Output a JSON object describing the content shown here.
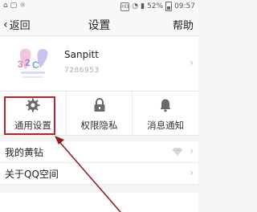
{
  "status_bar": {
    "battery_percent": "52%",
    "time": "09:57"
  },
  "nav": {
    "back_label": "返回",
    "title": "设置",
    "help_label": "帮助"
  },
  "profile": {
    "nickname": "Sanpitt",
    "qq_number": "7286953"
  },
  "grid": [
    {
      "label": "通用设置",
      "icon": "gear-icon"
    },
    {
      "label": "权限隐私",
      "icon": "lock-icon"
    },
    {
      "label": "消息通知",
      "icon": "bell-icon"
    }
  ],
  "list": [
    {
      "label": "我的黄钻",
      "icon": "diamond-icon"
    },
    {
      "label": "关于QQ空间"
    }
  ],
  "colors": {
    "highlight": "#b0262e",
    "arrow": "#8f1f25"
  }
}
